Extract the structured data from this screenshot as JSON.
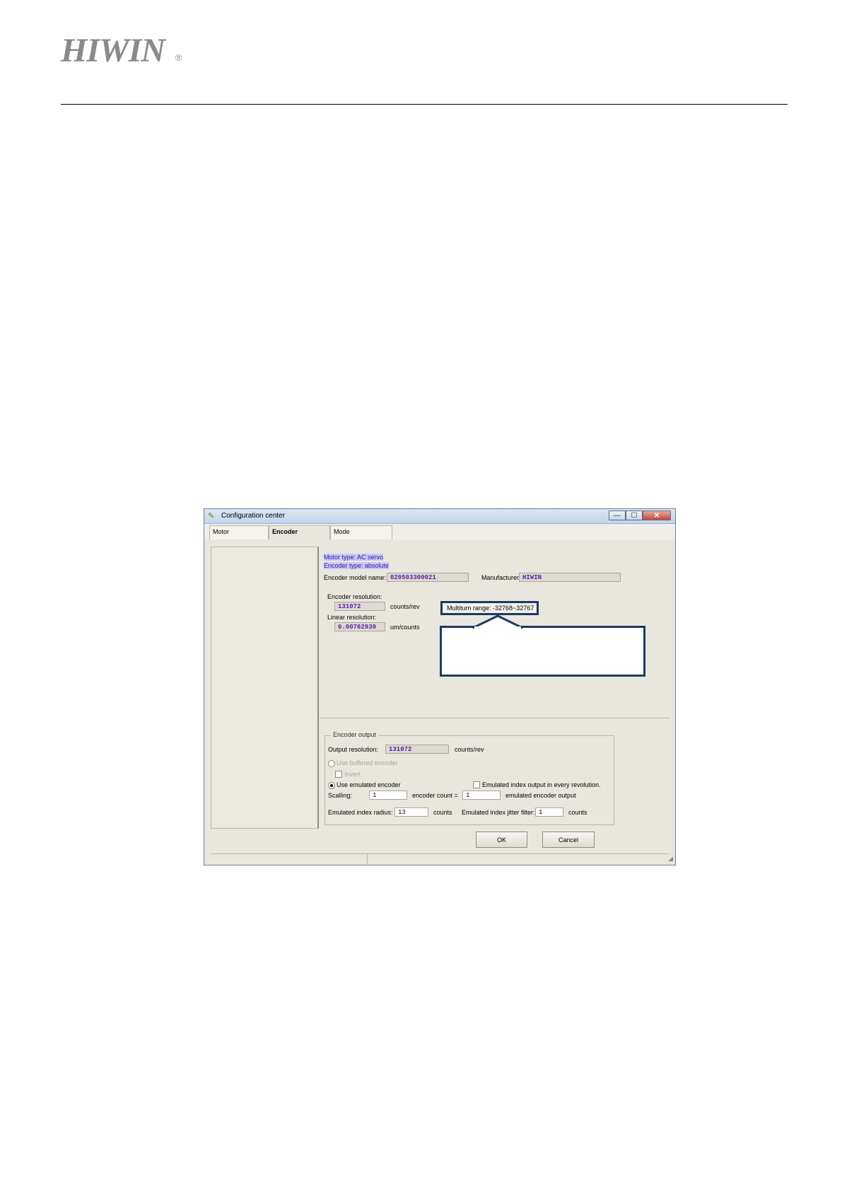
{
  "header": {
    "logo": "HIWIN",
    "logo_mark": "®"
  },
  "window": {
    "title": "Configuration center",
    "buttons": {
      "minimize": "—",
      "maximize": "☐",
      "close": "✕"
    },
    "tabs": [
      "Motor",
      "Encoder",
      "Mode"
    ],
    "motor_type": "Motor type: AC servo",
    "encoder_type": "Encoder type: absolute",
    "encoder_model_label": "Encoder model name:",
    "encoder_model_value": "020503300021",
    "manufacturer_label": "Manufacturer:",
    "manufacturer_value": "HIWIN",
    "encoder_resolution_label": "Encoder resolution:",
    "encoder_resolution_value": "131072",
    "encoder_resolution_unit": "counts/rev",
    "linear_resolution_label": "Linear resolution:",
    "linear_resolution_value": "0.00762939",
    "linear_resolution_unit": "um/counts",
    "multiturn_range": "Multiturn range: -32768~32767",
    "encoder_output": {
      "title": "Encoder output",
      "output_resolution_label": "Output resolution:",
      "output_resolution_value": "131072",
      "output_resolution_unit": "counts/rev",
      "use_buffered": "Use buffered encoder",
      "invert": "Invert",
      "use_emulated": "Use emulated encoder",
      "emulated_index_every_rev": "Emulated index output in every revolution.",
      "scaling_label": "Scalling:",
      "scaling_value": "1",
      "encoder_count_label": "encoder count =",
      "encoder_count_value": "1",
      "emulated_output_label": "emulated encoder output",
      "index_radius_label": "Emulated index radius:",
      "index_radius_value": "13",
      "index_radius_unit": "counts",
      "jitter_label": "Emulated index jitter filter:",
      "jitter_value": "1",
      "jitter_unit": "counts"
    },
    "ok": "OK",
    "cancel": "Cancel"
  }
}
